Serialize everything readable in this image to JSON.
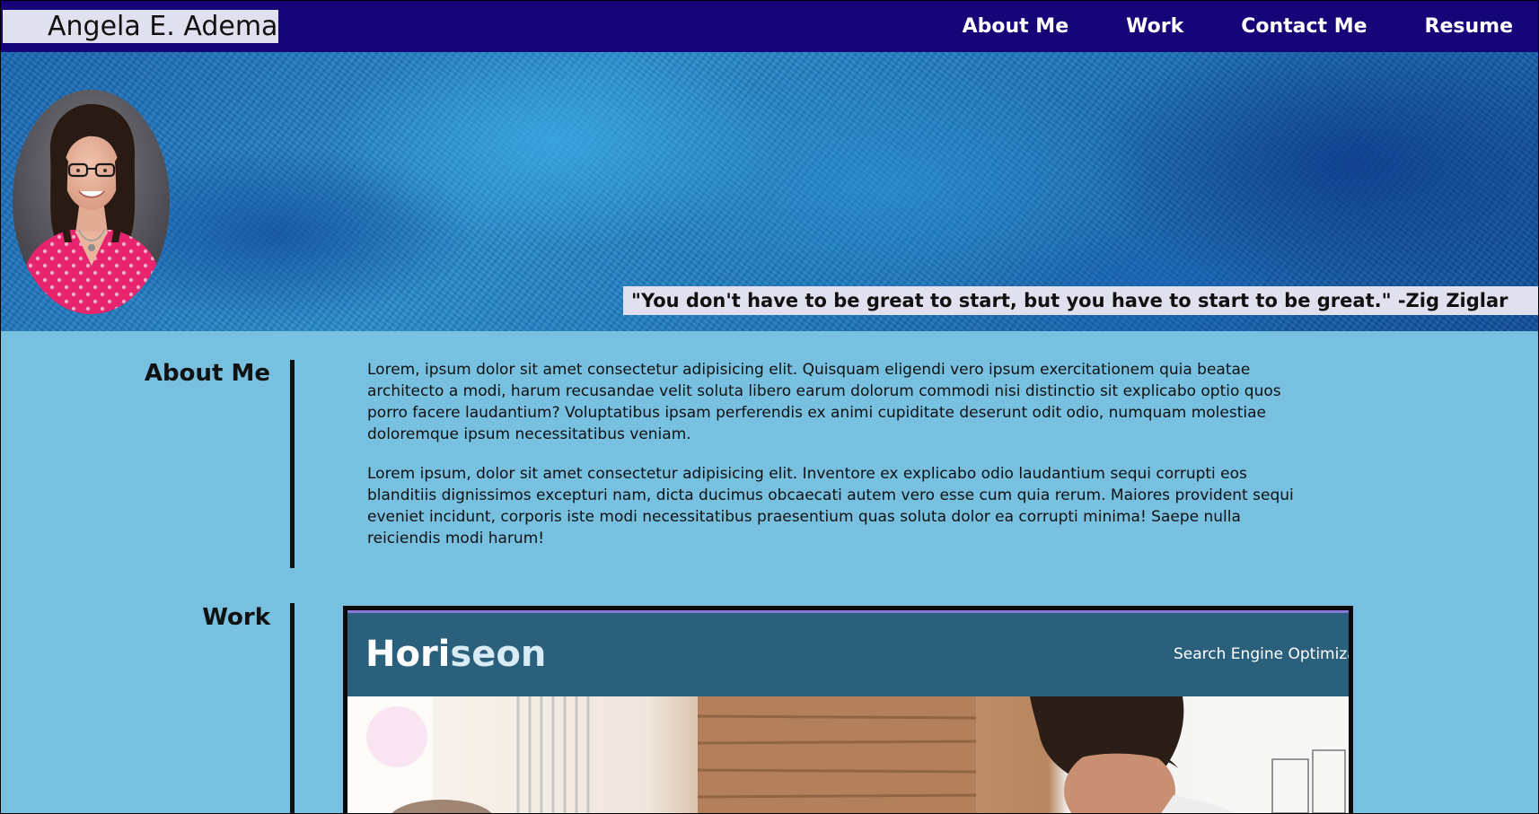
{
  "header": {
    "brand": "Angela E. Adema",
    "nav": [
      "About Me",
      "Work",
      "Contact Me",
      "Resume"
    ]
  },
  "hero": {
    "quote": "\"You don't have to be great to start, but you have to start to be great.\" -Zig Ziglar"
  },
  "about": {
    "title": "About Me",
    "paragraphs": [
      "Lorem, ipsum dolor sit amet consectetur adipisicing elit. Quisquam eligendi vero ipsum exercitationem quia beatae architecto a modi, harum recusandae velit soluta libero earum dolorum commodi nisi distinctio sit explicabo optio quos porro facere laudantium? Voluptatibus ipsam perferendis ex animi cupiditate deserunt odit odio, numquam molestiae doloremque ipsum necessitatibus veniam.",
      "Lorem ipsum, dolor sit amet consectetur adipisicing elit. Inventore ex explicabo odio laudantium sequi corrupti eos blanditiis dignissimos excepturi nam, dicta ducimus obcaecati autem vero esse cum quia rerum. Maiores provident sequi eveniet incidunt, corporis iste modi necessitatibus praesentium quas soluta dolor ea corrupti minima! Saepe nulla reiciendis modi harum!"
    ]
  },
  "work": {
    "title": "Work",
    "preview": {
      "logo_part1": "Hori",
      "logo_part2": "seon",
      "nav_text": "Search Engine Optimizat"
    }
  },
  "colors": {
    "navbar": "#150578",
    "page_background": "#78c0e0",
    "label_background": "#e0e0ee",
    "preview_header": "#2a607c"
  },
  "icons": {
    "profile_photo": "profile-photo",
    "hero_background": "blue-texture-banner"
  }
}
